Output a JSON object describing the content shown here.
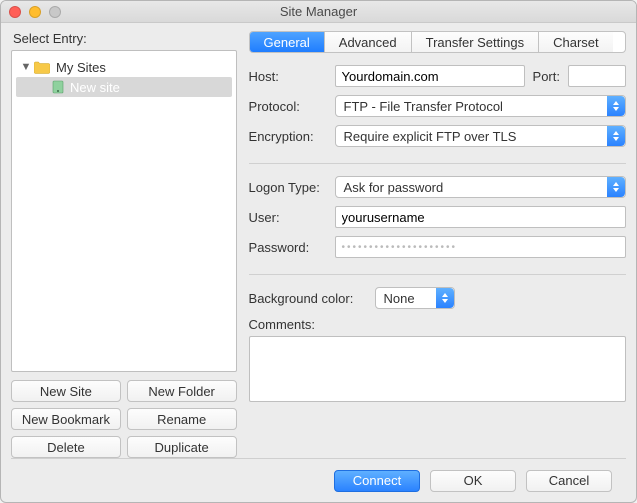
{
  "window": {
    "title": "Site Manager"
  },
  "left": {
    "label": "Select Entry:",
    "root": {
      "label": "My Sites"
    },
    "items": [
      {
        "label": "New site",
        "selected": true
      }
    ],
    "buttons": {
      "new_site": "New Site",
      "new_folder": "New Folder",
      "new_bookmark": "New Bookmark",
      "rename": "Rename",
      "delete": "Delete",
      "duplicate": "Duplicate"
    }
  },
  "tabs": {
    "general": "General",
    "advanced": "Advanced",
    "transfer": "Transfer Settings",
    "charset": "Charset",
    "active": "general"
  },
  "form": {
    "host_label": "Host:",
    "host_value": "Yourdomain.com",
    "port_label": "Port:",
    "port_value": "",
    "protocol_label": "Protocol:",
    "protocol_value": "FTP - File Transfer Protocol",
    "encryption_label": "Encryption:",
    "encryption_value": "Require explicit FTP over TLS",
    "logon_label": "Logon Type:",
    "logon_value": "Ask for password",
    "user_label": "User:",
    "user_value": "yourusername",
    "password_label": "Password:",
    "password_masked": "•••••••••••••••••••••",
    "bgcolor_label": "Background color:",
    "bgcolor_value": "None",
    "comments_label": "Comments:",
    "comments_value": ""
  },
  "footer": {
    "connect": "Connect",
    "ok": "OK",
    "cancel": "Cancel"
  }
}
